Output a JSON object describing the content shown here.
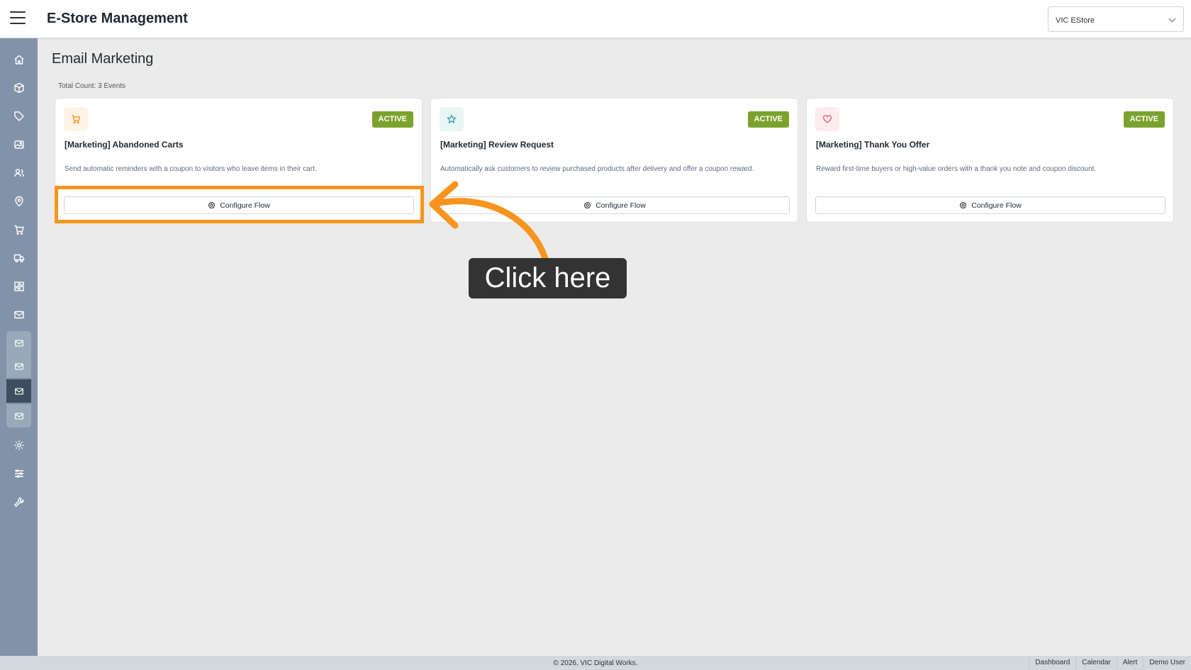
{
  "header": {
    "app_title": "E-Store Management",
    "store_selector": {
      "value": "VIC EStore"
    }
  },
  "sidebar": {
    "items": [
      {
        "icon": "home-icon"
      },
      {
        "icon": "box-icon"
      },
      {
        "icon": "tag-icon"
      },
      {
        "icon": "image-icon"
      },
      {
        "icon": "users-icon"
      },
      {
        "icon": "location-pin-icon"
      },
      {
        "icon": "cart-icon"
      },
      {
        "icon": "truck-icon"
      },
      {
        "icon": "grid-icon"
      },
      {
        "icon": "mail-icon",
        "expanded": true,
        "subitems": [
          {
            "icon": "mail-icon"
          },
          {
            "icon": "mail-icon"
          },
          {
            "icon": "mail-icon",
            "active": true
          },
          {
            "icon": "mail-icon"
          }
        ]
      },
      {
        "icon": "gear-icon"
      },
      {
        "icon": "sliders-icon"
      },
      {
        "icon": "wrench-icon"
      }
    ]
  },
  "main": {
    "page_title": "Email Marketing",
    "total_count": "Total Count: 3 Events",
    "cards": [
      {
        "icon": "cart-icon",
        "icon_color": "#f7941d",
        "icon_bg": "#fff3e6",
        "status": "ACTIVE",
        "title": "[Marketing] Abandoned Carts",
        "description": "Send automatic reminders with a coupon to visitors who leave items in their cart.",
        "button_label": "Configure Flow"
      },
      {
        "icon": "star-icon",
        "icon_color": "#2a9d8f",
        "icon_bg": "#e8f6f4",
        "status": "ACTIVE",
        "title": "[Marketing] Review Request",
        "description": "Automatically ask customers to review purchased products after delivery and offer a coupon reward.",
        "button_label": "Configure Flow"
      },
      {
        "icon": "heart-icon",
        "icon_color": "#e05a7a",
        "icon_bg": "#fdecef",
        "status": "ACTIVE",
        "title": "[Marketing] Thank You Offer",
        "description": "Reward first-time buyers or high-value orders with a thank you note and coupon discount.",
        "button_label": "Configure Flow"
      }
    ]
  },
  "annotation": {
    "callout_text": "Click here",
    "color": "#f7941d"
  },
  "footer": {
    "copyright": "© 2026, VIC Digital Works.",
    "links": [
      "Dashboard",
      "Calendar",
      "Alert",
      "Demo User"
    ]
  },
  "colors": {
    "status_active": "#7ba22c",
    "sidebar_bg": "#8292a8",
    "sidebar_active": "#3f4d5f"
  }
}
